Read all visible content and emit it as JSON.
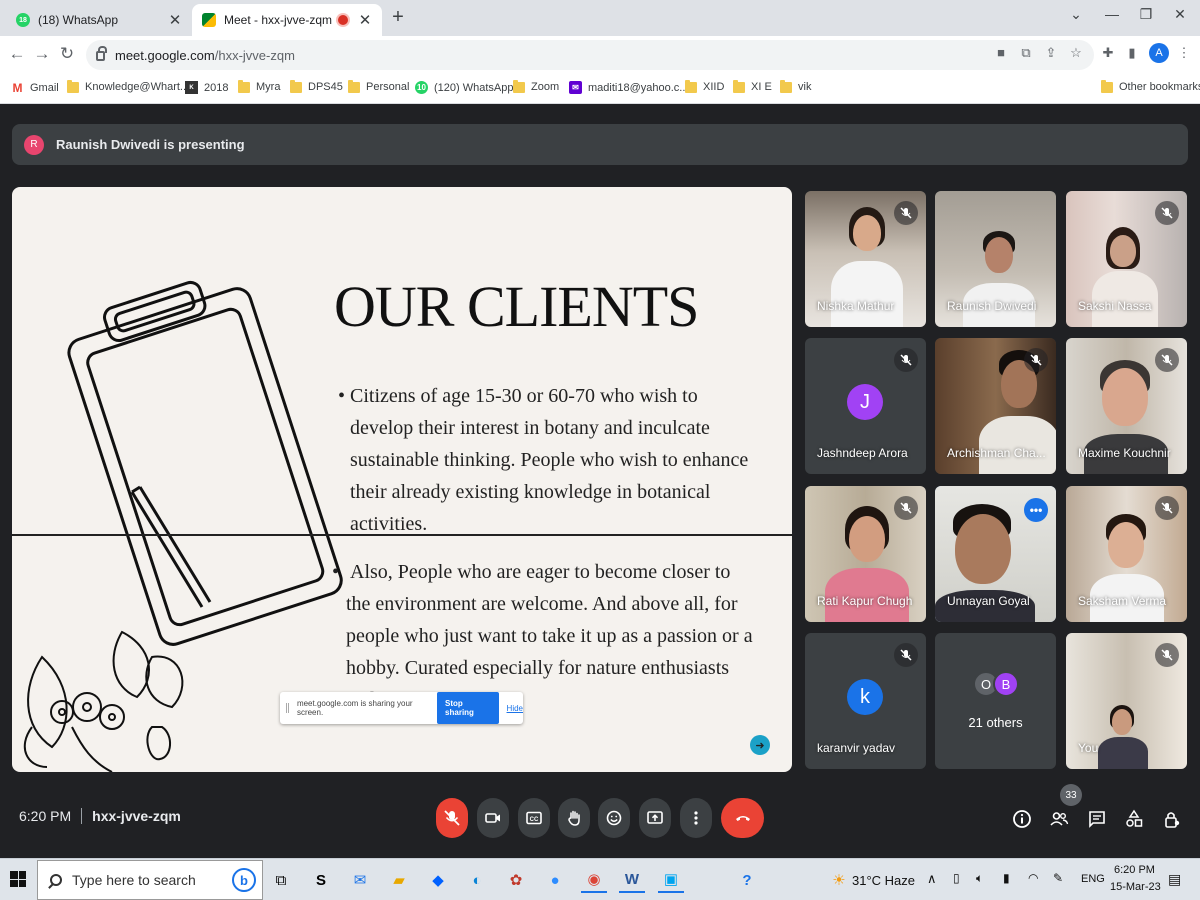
{
  "browser": {
    "tabs": [
      {
        "title": "(18) WhatsApp",
        "favicon_badge": "18"
      },
      {
        "title": "Meet - hxx-jvve-zqm"
      }
    ],
    "url_host": "meet.google.com",
    "url_path": "/hxx-jvve-zqm",
    "profile_initial": "A",
    "bookmarks": [
      {
        "label": "Gmail",
        "icon": "gmail-icon"
      },
      {
        "label": "Knowledge@Whart...",
        "icon": "folder-icon"
      },
      {
        "label": "2018",
        "icon": "kw-icon"
      },
      {
        "label": "Myra",
        "icon": "folder-icon"
      },
      {
        "label": "DPS45",
        "icon": "folder-icon"
      },
      {
        "label": "Personal",
        "icon": "folder-icon"
      },
      {
        "label": "(120) WhatsApp",
        "icon": "whatsapp-icon",
        "badge": "10"
      },
      {
        "label": "Zoom",
        "icon": "folder-icon"
      },
      {
        "label": "maditi18@yahoo.c...",
        "icon": "yahoo-icon"
      },
      {
        "label": "XIID",
        "icon": "folder-icon"
      },
      {
        "label": "XI E",
        "icon": "folder-icon"
      },
      {
        "label": "vik",
        "icon": "folder-icon"
      }
    ],
    "other_bookmarks": "Other bookmarks"
  },
  "meet": {
    "presenting": {
      "initial": "R",
      "text": "Raunish Dwivedi is presenting"
    },
    "slide": {
      "title": "OUR CLIENTS",
      "bullet1": "Citizens of age 15-30 or 60-70 who wish to develop their interest in botany and inculcate sustainable thinking. People who wish to enhance their already existing knowledge in botanical activities.",
      "bullet2": "Also, People who are eager to become closer to the environment are welcome. And above all, for people who just want to take it up as a passion or a hobby. Curated especially for nature enthusiasts and plant"
    },
    "share_popup": {
      "text": "meet.google.com is sharing your screen.",
      "stop": "Stop sharing",
      "hide": "Hide"
    },
    "participants": [
      {
        "name": "Nishka Mathur",
        "muted": true
      },
      {
        "name": "Raunish Dwivedi",
        "muted": false
      },
      {
        "name": "Sakshi Nassa",
        "muted": true
      },
      {
        "name": "Jashndeep Arora",
        "muted": true,
        "avatar": "J",
        "avatar_color": "#a142f4"
      },
      {
        "name": "Archishman Cha...",
        "muted": true
      },
      {
        "name": "Maxime Kouchnir",
        "muted": true
      },
      {
        "name": "Rati Kapur Chugh",
        "muted": true
      },
      {
        "name": "Unnayan Goyal",
        "muted": false,
        "speaking": true
      },
      {
        "name": "Saksham Verma",
        "muted": true
      },
      {
        "name": "karanvir yadav",
        "muted": true,
        "avatar": "k",
        "avatar_color": "#1a73e8"
      },
      {
        "name": "21 others",
        "others_avatars": [
          "O",
          "B"
        ]
      },
      {
        "name": "You",
        "muted": true
      }
    ],
    "time": "6:20 PM",
    "meeting_code": "hxx-jvve-zqm",
    "people_count": "33"
  },
  "taskbar": {
    "search_placeholder": "Type here to search",
    "weather": "31°C  Haze",
    "language": "ENG",
    "clock_time": "6:20 PM",
    "clock_date": "15-Mar-23"
  }
}
